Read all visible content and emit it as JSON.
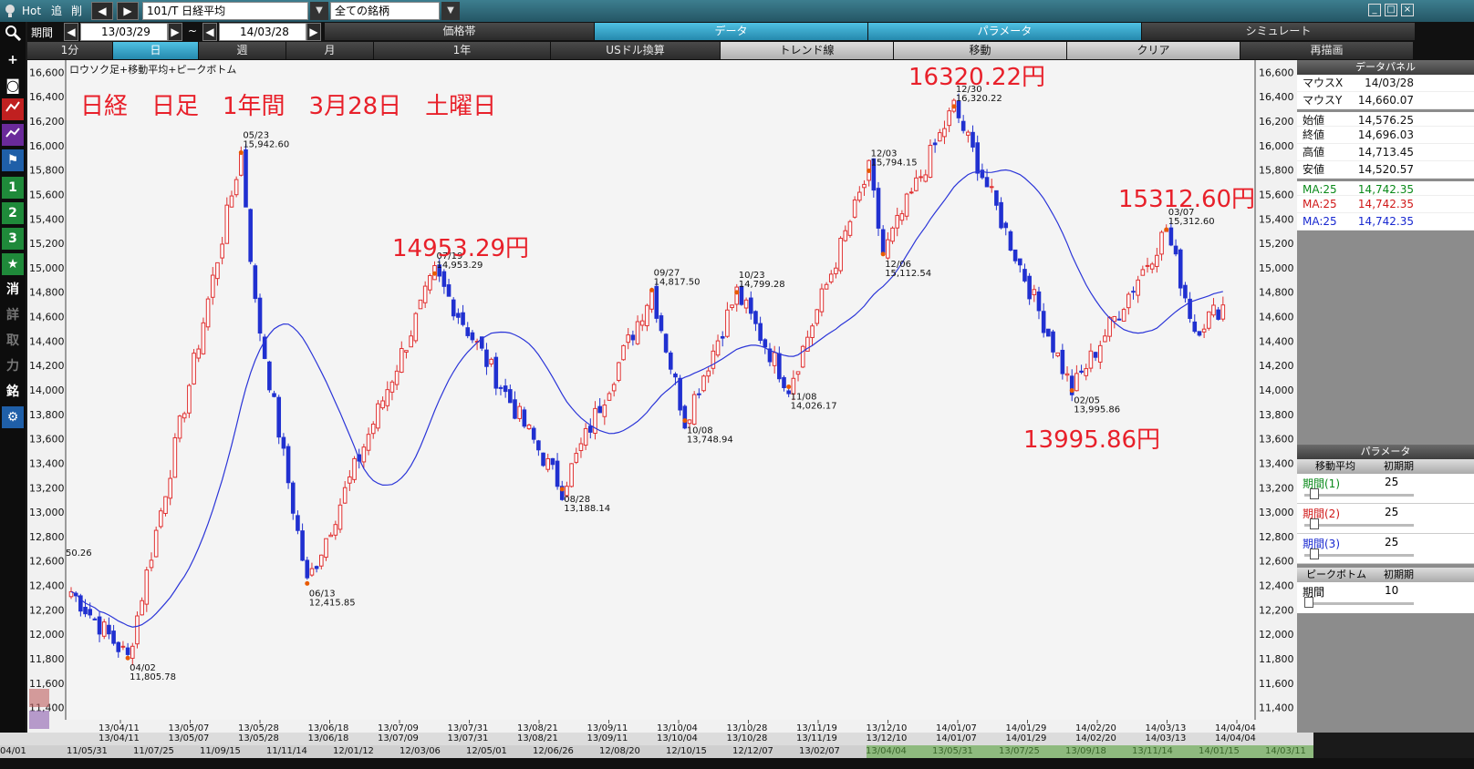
{
  "toolbar": {
    "hot": "Hot",
    "back": "追",
    "delete": "削",
    "symbol": "101/T 日経平均",
    "universe": "全ての銘柄",
    "period_label": "期間",
    "start_date": "13/03/29",
    "tilde": "~",
    "end_date": "14/03/28"
  },
  "menus": [
    "価格帯",
    "データ",
    "パラメータ",
    "シミュレート"
  ],
  "timeframes": [
    "1分",
    "日",
    "週",
    "月",
    "1年"
  ],
  "tools": [
    "USドル換算",
    "トレンド線",
    "移動",
    "クリア",
    "再描画"
  ],
  "chart_data": {
    "type": "candlestick",
    "subtitle": "ロウソク足+移動平均+ピークボトム",
    "annotation_title": "日経　日足　1年間　3月28日　土曜日",
    "y_ticks": [
      16600,
      16400,
      16200,
      16000,
      15800,
      15600,
      15400,
      15200,
      15000,
      14800,
      14600,
      14400,
      14200,
      14000,
      13800,
      13600,
      13400,
      13200,
      13000,
      12800,
      12600,
      12400,
      12200,
      12000,
      11800,
      11600,
      11400
    ],
    "y_tick_labels": [
      "16,600",
      "16,400",
      "16,200",
      "16,000",
      "15,800",
      "15,600",
      "15,400",
      "15,200",
      "15,000",
      "14,800",
      "14,600",
      "14,400",
      "14,200",
      "14,000",
      "13,800",
      "13,600",
      "13,400",
      "13,200",
      "13,000",
      "12,800",
      "12,600",
      "12,400",
      "12,200",
      "12,000",
      "11,800",
      "11,600",
      "11,400"
    ],
    "ylim": [
      11300,
      16700
    ],
    "x_ticks": [
      "13/04/11",
      "13/05/07",
      "13/05/28",
      "13/06/18",
      "13/07/09",
      "13/07/31",
      "13/08/21",
      "13/09/11",
      "13/10/04",
      "13/10/28",
      "13/11/19",
      "13/12/10",
      "14/01/07",
      "14/01/29",
      "14/02/20",
      "14/03/13",
      "14/04/04"
    ],
    "peaks": [
      {
        "date": "04/02",
        "value": "11,805.78",
        "v": 11805.78,
        "type": "bottom"
      },
      {
        "date": "05/23",
        "value": "15,942.60",
        "v": 15942.6,
        "type": "peak"
      },
      {
        "date": "06/13",
        "value": "12,415.85",
        "v": 12415.85,
        "type": "bottom"
      },
      {
        "date": "07/19",
        "value": "14,953.29",
        "v": 14953.29,
        "type": "peak"
      },
      {
        "date": "08/28",
        "value": "13,188.14",
        "v": 13188.14,
        "type": "bottom"
      },
      {
        "date": "09/27",
        "value": "14,817.50",
        "v": 14817.5,
        "type": "peak"
      },
      {
        "date": "10/08",
        "value": "13,748.94",
        "v": 13748.94,
        "type": "bottom"
      },
      {
        "date": "10/23",
        "value": "14,799.28",
        "v": 14799.28,
        "type": "peak"
      },
      {
        "date": "11/08",
        "value": "14,026.17",
        "v": 14026.17,
        "type": "bottom"
      },
      {
        "date": "12/03",
        "value": "15,794.15",
        "v": 15794.15,
        "type": "peak"
      },
      {
        "date": "12/06",
        "value": "15,112.54",
        "v": 15112.54,
        "type": "bottom"
      },
      {
        "date": "12/30",
        "value": "16,320.22",
        "v": 16320.22,
        "type": "peak"
      },
      {
        "date": "02/05",
        "value": "13,995.86",
        "v": 13995.86,
        "type": "bottom"
      },
      {
        "date": "03/07",
        "value": "15,312.60",
        "v": 15312.6,
        "type": "peak"
      }
    ],
    "callouts": [
      "16320.22円",
      "15312.60円",
      "14953.29円",
      "13995.86円"
    ],
    "edge_label": "50.26",
    "ma_period": 25,
    "ma_color": "#2b35d8",
    "up_color": "#e03030",
    "down_color": "#2030d0"
  },
  "data_panel": {
    "title": "データパネル",
    "rows": [
      {
        "k": "マウスX",
        "v": "14/03/28"
      },
      {
        "k": "マウスY",
        "v": "14,660.07"
      },
      {
        "k": "始値",
        "v": "14,576.25"
      },
      {
        "k": "終値",
        "v": "14,696.03"
      },
      {
        "k": "高値",
        "v": "14,713.45"
      },
      {
        "k": "安値",
        "v": "14,520.57"
      },
      {
        "k": "MA:25",
        "v": "14,742.35"
      },
      {
        "k": "MA:25",
        "v": "14,742.35"
      },
      {
        "k": "MA:25",
        "v": "14,742.35"
      }
    ]
  },
  "param_panel": {
    "title": "パラメータ",
    "ma_label": "移動平均",
    "reset": "初期期",
    "periods": [
      {
        "label": "期間(1)",
        "value": "25"
      },
      {
        "label": "期間(2)",
        "value": "25"
      },
      {
        "label": "期間(3)",
        "value": "25"
      }
    ],
    "pb_label": "ピークボトム",
    "pb_reset": "初期期",
    "pb_period_label": "期間",
    "pb_period_value": "10"
  },
  "bottom_row1": [
    "04/01",
    "11/05/31",
    "11/07/25",
    "11/09/15",
    "11/11/14",
    "12/01/12",
    "12/03/06",
    "12/05/01",
    "12/06/26",
    "12/08/20",
    "12/10/15",
    "12/12/07",
    "13/02/07",
    "13/04/04",
    "13/05/31",
    "13/07/25",
    "13/09/18",
    "13/11/14",
    "14/01/15",
    "14/03/11"
  ],
  "side_icons": [
    "search-icon",
    "plus-icon",
    "camera-icon",
    "chart-red-icon",
    "chart-purple-icon",
    "flag-icon",
    "1",
    "2",
    "3",
    "star-icon",
    "消",
    "詳",
    "取",
    "力",
    "銘",
    "gear-icon"
  ]
}
